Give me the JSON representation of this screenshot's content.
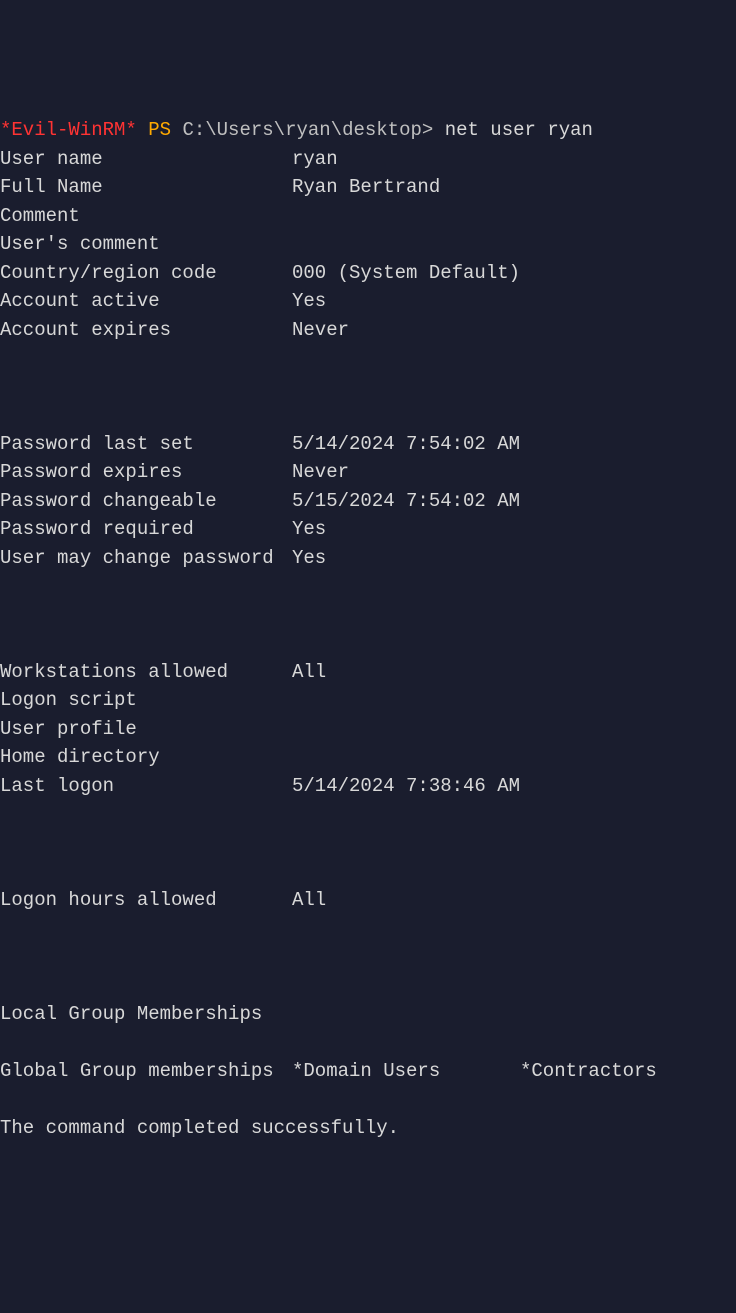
{
  "prompt": {
    "prefix": "*Evil-WinRM*",
    "ps": "PS",
    "path": "C:\\Users\\ryan\\desktop>",
    "command": "net user ryan"
  },
  "user_info": {
    "block1": [
      {
        "label": "User name",
        "value": "ryan"
      },
      {
        "label": "Full Name",
        "value": "Ryan Bertrand"
      },
      {
        "label": "Comment",
        "value": ""
      },
      {
        "label": "User's comment",
        "value": ""
      },
      {
        "label": "Country/region code",
        "value": "000 (System Default)"
      },
      {
        "label": "Account active",
        "value": "Yes"
      },
      {
        "label": "Account expires",
        "value": "Never"
      }
    ],
    "block2": [
      {
        "label": "Password last set",
        "value": "5/14/2024 7:54:02 AM"
      },
      {
        "label": "Password expires",
        "value": "Never"
      },
      {
        "label": "Password changeable",
        "value": "5/15/2024 7:54:02 AM"
      },
      {
        "label": "Password required",
        "value": "Yes"
      },
      {
        "label": "User may change password",
        "value": "Yes"
      }
    ],
    "block3": [
      {
        "label": "Workstations allowed",
        "value": "All"
      },
      {
        "label": "Logon script",
        "value": ""
      },
      {
        "label": "User profile",
        "value": ""
      },
      {
        "label": "Home directory",
        "value": ""
      },
      {
        "label": "Last logon",
        "value": "5/14/2024 7:38:46 AM"
      }
    ],
    "block4": [
      {
        "label": "Logon hours allowed",
        "value": "All"
      }
    ]
  },
  "groups": {
    "local_label": "Local Group Memberships",
    "global_label": "Global Group memberships",
    "global_value1": "*Domain Users",
    "global_value2": "*Contractors"
  },
  "final_message": "The command completed successfully."
}
